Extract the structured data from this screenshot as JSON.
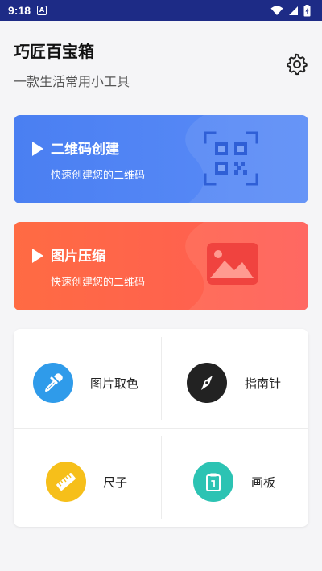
{
  "status_bar": {
    "time": "9:18",
    "notification_badge": "A",
    "icons": [
      "wifi-icon",
      "signal-icon",
      "battery-icon"
    ]
  },
  "header": {
    "title": "巧匠百宝箱",
    "subtitle": "一款生活常用小工具",
    "settings_icon": "gear-icon"
  },
  "feature_cards": [
    {
      "title": "二维码创建",
      "description": "快速创建您的二维码",
      "icon": "qr-code-icon",
      "color": "#4a7ff2"
    },
    {
      "title": "图片压缩",
      "description": "快速创建您的二维码",
      "icon": "image-icon",
      "color": "#ff6148"
    }
  ],
  "tools": [
    {
      "label": "图片取色",
      "icon": "eyedropper-icon",
      "color": "#2f9bea"
    },
    {
      "label": "指南针",
      "icon": "compass-icon",
      "color": "#222222"
    },
    {
      "label": "尺子",
      "icon": "ruler-icon",
      "color": "#f6bf1a"
    },
    {
      "label": "画板",
      "icon": "clipboard-icon",
      "color": "#2cc3b3"
    }
  ]
}
